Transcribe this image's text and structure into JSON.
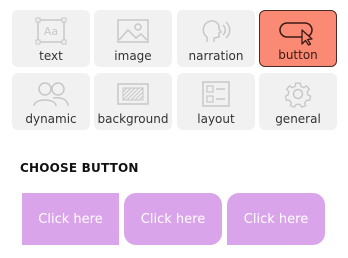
{
  "tiles": [
    {
      "label": "text",
      "icon": "text-box-icon"
    },
    {
      "label": "image",
      "icon": "image-icon"
    },
    {
      "label": "narration",
      "icon": "narration-icon"
    },
    {
      "label": "button",
      "icon": "button-cursor-icon",
      "active": true
    },
    {
      "label": "dynamic",
      "icon": "users-icon"
    },
    {
      "label": "background",
      "icon": "background-icon"
    },
    {
      "label": "layout",
      "icon": "layout-icon"
    },
    {
      "label": "general",
      "icon": "gear-icon"
    }
  ],
  "section": {
    "heading": "CHOOSE BUTTON"
  },
  "buttons": [
    {
      "label": "Click here",
      "style": "square"
    },
    {
      "label": "Click here",
      "style": "rounded"
    },
    {
      "label": "Click here",
      "style": "rounded-cut"
    }
  ],
  "colors": {
    "tile_bg": "#f1f1f1",
    "active_tile_bg": "#fb8a74",
    "button_bg": "#d9a4ea",
    "icon_gray": "#c7c7c7"
  }
}
